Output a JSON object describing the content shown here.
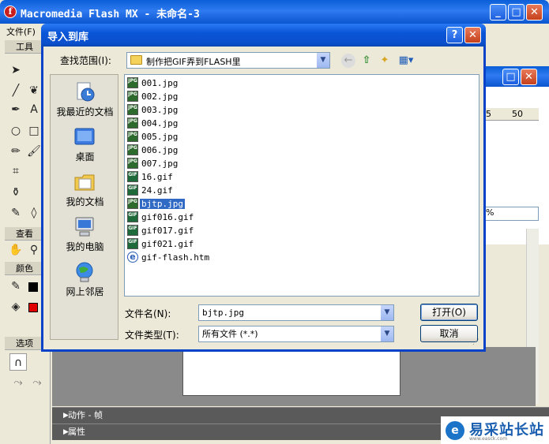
{
  "app": {
    "title": "Macromedia Flash MX - 未命名-3",
    "logo_glyph": "f",
    "menu_file": "文件(F)",
    "minimize_glyph": "_",
    "maximize_glyph": "□",
    "close_glyph": "✕"
  },
  "tools_panel": {
    "title": "工具",
    "view_label": "查看",
    "colors_label": "颜色",
    "options_label": "选项"
  },
  "panels": {
    "actions": "动作 - 帧",
    "properties": "属性"
  },
  "ruler": {
    "tick_5": "5",
    "tick_50": "50"
  },
  "zoom": {
    "value": "%"
  },
  "watermark": {
    "text": "易采站长站",
    "sub": "www.easck.com"
  },
  "dialog": {
    "title": "导入到库",
    "help_glyph": "?",
    "close_glyph": "✕",
    "look_in_label": "查找范围(I):",
    "look_in_value": "制作把GIF弄到FLASH里",
    "places": [
      {
        "label": "我最近的文档",
        "icon": "recent-docs-icon"
      },
      {
        "label": "桌面",
        "icon": "desktop-icon"
      },
      {
        "label": "我的文档",
        "icon": "my-documents-icon"
      },
      {
        "label": "我的电脑",
        "icon": "my-computer-icon"
      },
      {
        "label": "网上邻居",
        "icon": "network-places-icon"
      }
    ],
    "files": [
      {
        "name": "001.jpg",
        "type": "jpg",
        "tag": "JPG"
      },
      {
        "name": "002.jpg",
        "type": "jpg",
        "tag": "JPG"
      },
      {
        "name": "003.jpg",
        "type": "jpg",
        "tag": "JPG"
      },
      {
        "name": "004.jpg",
        "type": "jpg",
        "tag": "JPG"
      },
      {
        "name": "005.jpg",
        "type": "jpg",
        "tag": "JPG"
      },
      {
        "name": "006.jpg",
        "type": "jpg",
        "tag": "JPG"
      },
      {
        "name": "007.jpg",
        "type": "jpg",
        "tag": "JPG"
      },
      {
        "name": "16.gif",
        "type": "gif",
        "tag": "GIF"
      },
      {
        "name": "24.gif",
        "type": "gif",
        "tag": "GIF"
      },
      {
        "name": "bjtp.jpg",
        "type": "jpg",
        "tag": "JPG"
      },
      {
        "name": "gif016.gif",
        "type": "gif",
        "tag": "GIF"
      },
      {
        "name": "gif017.gif",
        "type": "gif",
        "tag": "GIF"
      },
      {
        "name": "gif021.gif",
        "type": "gif",
        "tag": "GIF"
      },
      {
        "name": "gif-flash.htm",
        "type": "htm",
        "tag": "e"
      }
    ],
    "selected_file": "bjtp.jpg",
    "filename_label": "文件名(N):",
    "filename_value": "bjtp.jpg",
    "filetype_label": "文件类型(T):",
    "filetype_value": "所有文件 (*.*)",
    "open_button": "打开(O)",
    "cancel_button": "取消",
    "combo_arrow_glyph": "▼"
  }
}
